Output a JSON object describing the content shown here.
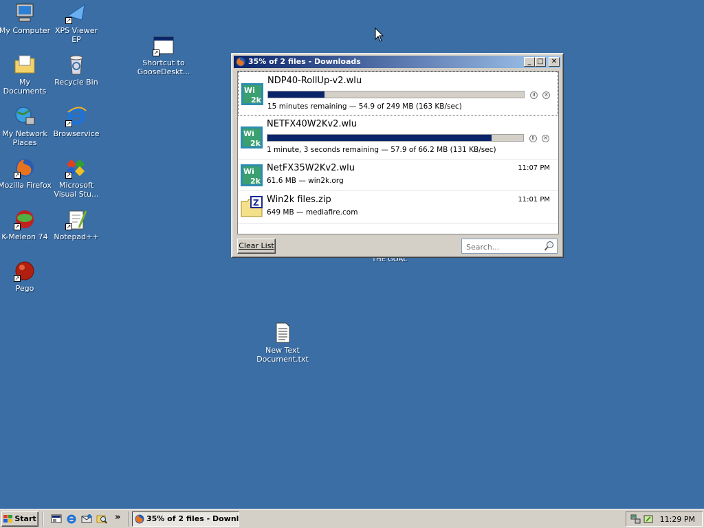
{
  "desktop": {
    "icons": [
      {
        "label": "My Computer",
        "icon": "my-computer-icon"
      },
      {
        "label": "XPS Viewer EP",
        "icon": "xps-viewer-icon"
      },
      {
        "label": "Shortcut to GooseDeskt...",
        "icon": "shortcut-window-icon"
      },
      {
        "label": "My Documents",
        "icon": "my-documents-icon"
      },
      {
        "label": "Recycle Bin",
        "icon": "recycle-bin-icon"
      },
      {
        "label": "My Network Places",
        "icon": "network-places-icon"
      },
      {
        "label": "Browservice",
        "icon": "internet-explorer-icon"
      },
      {
        "label": "Mozilla Firefox",
        "icon": "firefox-icon"
      },
      {
        "label": "Microsoft Visual Stu...",
        "icon": "visual-studio-icon"
      },
      {
        "label": "K-Meleon 74",
        "icon": "k-meleon-icon"
      },
      {
        "label": "Notepad++",
        "icon": "notepad-plus-plus-icon"
      },
      {
        "label": "Pego",
        "icon": "pego-icon"
      },
      {
        "label": "New Text Document.txt",
        "icon": "text-document-icon"
      }
    ],
    "hidden_label": "THE GOAL"
  },
  "window": {
    "title": "35% of 2 files - Downloads",
    "controls": {
      "minimize": "_",
      "maximize": "□",
      "close": "✕"
    },
    "downloads": [
      {
        "name": "NDP40-RollUp-v2.wlu",
        "status": "15 minutes remaining — 54.9 of 249 MB (163 KB/sec)",
        "progress": 0.22,
        "time": "",
        "active": true
      },
      {
        "name": "NETFX40W2Kv2.wlu",
        "status": "1 minute, 3 seconds remaining — 57.9 of 66.2 MB (131 KB/sec)",
        "progress": 0.875,
        "time": "",
        "active": true
      },
      {
        "name": "NetFX35W2Kv2.wlu",
        "status": "61.6 MB — win2k.org",
        "time": "11:07 PM",
        "active": false
      },
      {
        "name": "Win2k files.zip",
        "status": "649 MB — mediafire.com",
        "time": "11:01 PM",
        "active": false
      }
    ],
    "pause_glyph": "II",
    "cancel_glyph": "✕",
    "clear_list": "Clear List",
    "search_placeholder": "Search..."
  },
  "taskbar": {
    "start": "Start",
    "chevron": "»",
    "task_label": "35% of 2 files - Downl...",
    "clock": "11:29 PM"
  },
  "colors": {
    "desktop": "#3a6ea5",
    "titlebar_start": "#0a246a",
    "titlebar_end": "#a6caf0",
    "progress_fill": "#0a246a",
    "chrome": "#d4d0c8"
  }
}
